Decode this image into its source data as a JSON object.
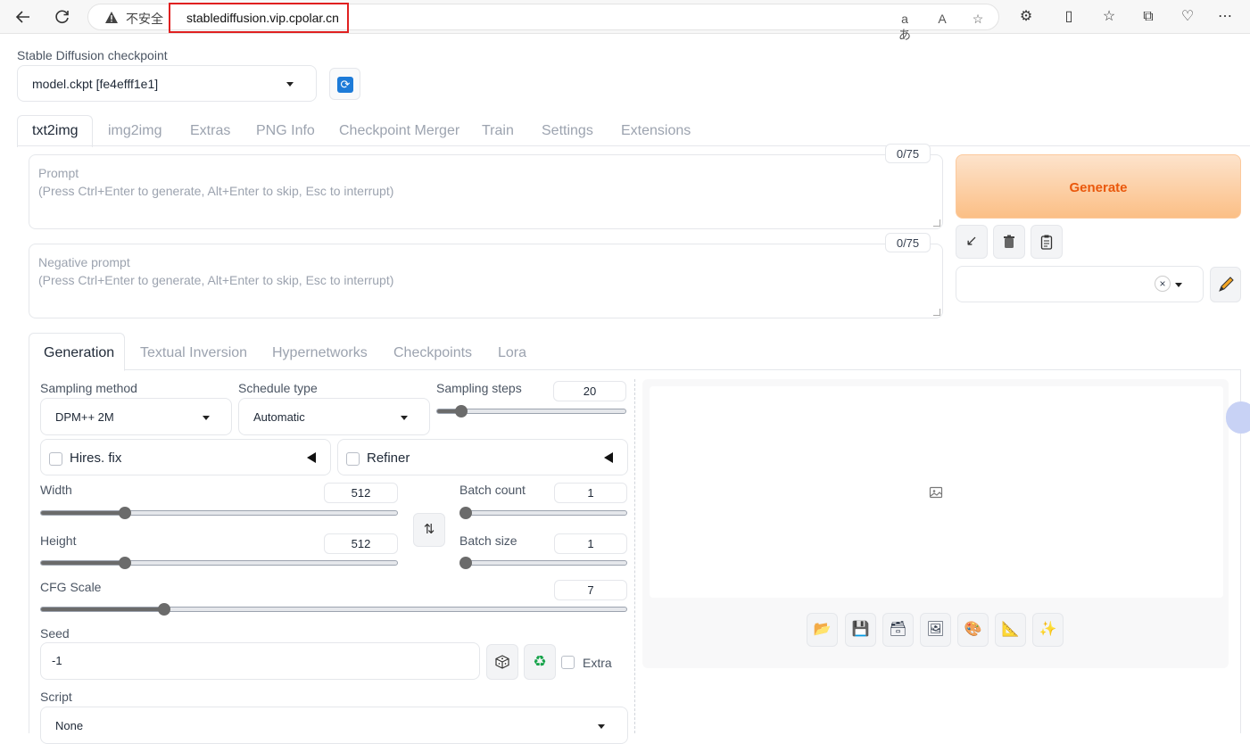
{
  "browser": {
    "insecure_label": "不安全",
    "url": "stablediffusion.vip.cpolar.cn"
  },
  "checkpoint": {
    "label": "Stable Diffusion checkpoint",
    "value": "model.ckpt [fe4efff1e1]"
  },
  "tabs": [
    "txt2img",
    "img2img",
    "Extras",
    "PNG Info",
    "Checkpoint Merger",
    "Train",
    "Settings",
    "Extensions"
  ],
  "prompt": {
    "label": "Prompt",
    "placeholder": "(Press Ctrl+Enter to generate, Alt+Enter to skip, Esc to interrupt)",
    "token_count": "0/75"
  },
  "negative_prompt": {
    "label": "Negative prompt",
    "placeholder": "(Press Ctrl+Enter to generate, Alt+Enter to skip, Esc to interrupt)",
    "token_count": "0/75"
  },
  "generate_label": "Generate",
  "sub_tabs": [
    "Generation",
    "Textual Inversion",
    "Hypernetworks",
    "Checkpoints",
    "Lora"
  ],
  "sampling_method": {
    "label": "Sampling method",
    "value": "DPM++ 2M"
  },
  "schedule_type": {
    "label": "Schedule type",
    "value": "Automatic"
  },
  "sampling_steps": {
    "label": "Sampling steps",
    "value": "20",
    "fraction": 0.13
  },
  "hires_fix": {
    "label": "Hires. fix"
  },
  "refiner": {
    "label": "Refiner"
  },
  "width": {
    "label": "Width",
    "value": "512",
    "fraction": 0.235
  },
  "height": {
    "label": "Height",
    "value": "512",
    "fraction": 0.235
  },
  "batch_count": {
    "label": "Batch count",
    "value": "1",
    "fraction": 0.0
  },
  "batch_size": {
    "label": "Batch size",
    "value": "1",
    "fraction": 0.0
  },
  "cfg_scale": {
    "label": "CFG Scale",
    "value": "7",
    "fraction": 0.21
  },
  "seed": {
    "label": "Seed",
    "value": "-1",
    "extra_label": "Extra"
  },
  "script": {
    "label": "Script",
    "value": "None"
  },
  "colors": {
    "accent_orange": "#ea580c",
    "slider_fill": "#6b6b6b",
    "url_highlight": "#e02020"
  }
}
